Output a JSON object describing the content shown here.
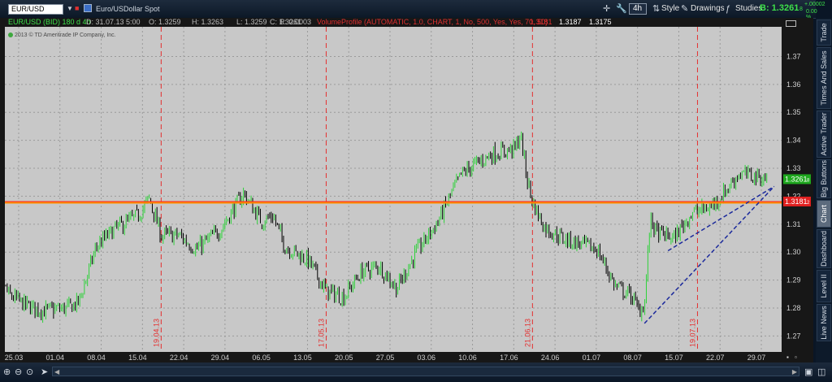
{
  "toolbar": {
    "timeframe": "4h",
    "style_label": "Style",
    "drawings_label": "Drawings",
    "studies_label": "Studies",
    "bid_label": "B: 1.3261",
    "bid_sub": "8",
    "change_top": "+.00002",
    "change_bottom": "0.00 %"
  },
  "symbol_bar": {
    "symbol": "EUR/USD",
    "description": "Euro/USDollar Spot",
    "chart_label": "EUR/USD (BID) 180 d 4h",
    "date": "D: 31.07.13 5:00",
    "open": "O: 1.3259",
    "high": "H: 1.3263",
    "low": "L: 1.3259",
    "close": "C: 1.3261",
    "range": "R: 0.0003",
    "volume_profile": "VolumeProfile (AUTOMATIC, 1.0, CHART, 1, No, 500, Yes, Yes, 70, 50)",
    "vp_value1": "1.3181",
    "vp_value2": "1.3187",
    "vp_value3": "1.3175",
    "copyright": "2013 © TD Ameritrade IP Company, Inc."
  },
  "side_tabs": [
    "Trade",
    "Times And Sales",
    "Active Trader",
    "Big Buttons",
    "Chart",
    "Dashboard",
    "Level II",
    "Live News"
  ],
  "active_side_tab": "Chart",
  "colors": {
    "up": "#2ed23a",
    "down": "#000000",
    "hline": "#ff8c00",
    "marker": "#e53030",
    "trend": "#1c2a9c",
    "current_badge": "#1ea81e",
    "vp_badge": "#e02020"
  },
  "chart_data": {
    "type": "candlestick",
    "title": "EUR/USD (BID) 180 d 4h",
    "x_tick_labels": [
      "25.03",
      "01.04",
      "08.04",
      "15.04",
      "22.04",
      "29.04",
      "06.05",
      "13.05",
      "20.05",
      "27.05",
      "03.06",
      "10.06",
      "17.06",
      "24.06",
      "01.07",
      "08.07",
      "15.07",
      "22.07",
      "29.07"
    ],
    "y_ticks": [
      1.27,
      1.28,
      1.29,
      1.3,
      1.31,
      1.32,
      1.33,
      1.34,
      1.35,
      1.36,
      1.37
    ],
    "ylim": [
      1.2643,
      1.3806
    ],
    "grid": true,
    "price_path": [
      {
        "date": "21.03",
        "price": 1.3
      },
      {
        "date": "22.03",
        "price": 1.295
      },
      {
        "date": "24.03",
        "price": 1.285
      },
      {
        "date": "27.03",
        "price": 1.281
      },
      {
        "date": "30.03",
        "price": 1.279
      },
      {
        "date": "03.04",
        "price": 1.28
      },
      {
        "date": "05.04",
        "price": 1.282
      },
      {
        "date": "08.04",
        "price": 1.302
      },
      {
        "date": "11.04",
        "price": 1.308
      },
      {
        "date": "15.04",
        "price": 1.313
      },
      {
        "date": "17.04",
        "price": 1.319
      },
      {
        "date": "19.04",
        "price": 1.306
      },
      {
        "date": "22.04",
        "price": 1.306
      },
      {
        "date": "25.04",
        "price": 1.301
      },
      {
        "date": "29.04",
        "price": 1.308
      },
      {
        "date": "03.05",
        "price": 1.321
      },
      {
        "date": "06.05",
        "price": 1.311
      },
      {
        "date": "08.05",
        "price": 1.313
      },
      {
        "date": "10.05",
        "price": 1.302
      },
      {
        "date": "14.05",
        "price": 1.297
      },
      {
        "date": "17.05",
        "price": 1.286
      },
      {
        "date": "20.05",
        "price": 1.284
      },
      {
        "date": "23.05",
        "price": 1.293
      },
      {
        "date": "26.05",
        "price": 1.295
      },
      {
        "date": "29.05",
        "price": 1.287
      },
      {
        "date": "01.06",
        "price": 1.299
      },
      {
        "date": "05.06",
        "price": 1.311
      },
      {
        "date": "07.06",
        "price": 1.32
      },
      {
        "date": "09.06",
        "price": 1.328
      },
      {
        "date": "11.06",
        "price": 1.331
      },
      {
        "date": "14.06",
        "price": 1.335
      },
      {
        "date": "18.06",
        "price": 1.337
      },
      {
        "date": "19.06",
        "price": 1.342
      },
      {
        "date": "20.06",
        "price": 1.327
      },
      {
        "date": "21.06",
        "price": 1.318
      },
      {
        "date": "23.06",
        "price": 1.309
      },
      {
        "date": "26.06",
        "price": 1.305
      },
      {
        "date": "29.06",
        "price": 1.303
      },
      {
        "date": "02.07",
        "price": 1.301
      },
      {
        "date": "05.07",
        "price": 1.288
      },
      {
        "date": "08.07",
        "price": 1.284
      },
      {
        "date": "09.07",
        "price": 1.279
      },
      {
        "date": "10.07",
        "price": 1.281
      },
      {
        "date": "11.07",
        "price": 1.312
      },
      {
        "date": "12.07",
        "price": 1.307
      },
      {
        "date": "15.07",
        "price": 1.305
      },
      {
        "date": "18.07",
        "price": 1.314
      },
      {
        "date": "21.07",
        "price": 1.316
      },
      {
        "date": "23.07",
        "price": 1.32
      },
      {
        "date": "26.07",
        "price": 1.328
      },
      {
        "date": "29.07",
        "price": 1.327
      },
      {
        "date": "31.07",
        "price": 1.3261
      }
    ],
    "horizontal_line": {
      "price": 1.3181,
      "label": "1.3181",
      "sub": "2"
    },
    "current_price": {
      "price": 1.3261,
      "label": "1.3261",
      "sub": "8"
    },
    "vertical_markers": [
      {
        "date": "19.04.13",
        "x_date": "19.04"
      },
      {
        "date": "17.05.13",
        "x_date": "17.05"
      },
      {
        "date": "21.06.13",
        "x_date": "21.06"
      },
      {
        "date": "19.07.13",
        "x_date": "19.07"
      }
    ],
    "trendlines": [
      {
        "from": {
          "date": "10.07",
          "price": 1.2745
        },
        "to": {
          "date": "01.08",
          "price": 1.3235
        }
      },
      {
        "from": {
          "date": "14.07",
          "price": 1.3005
        },
        "to": {
          "date": "01.08",
          "price": 1.3235
        }
      }
    ]
  }
}
